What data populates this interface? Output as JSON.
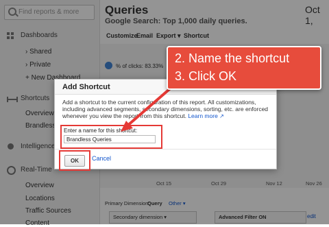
{
  "sidebar": {
    "search_placeholder": "Find reports & more",
    "dashboards": "Dashboards",
    "shared": "› Shared",
    "private": "› Private",
    "new_dashboard": "+ New Dashboard",
    "shortcuts": "Shortcuts",
    "overview": "Overview",
    "brandless": "Brandless Q",
    "intelligence": "Intelligence E",
    "realtime": "Real-Time",
    "rt_overview": "Overview",
    "rt_locations": "Locations",
    "rt_traffic": "Traffic Sources",
    "rt_content": "Content"
  },
  "main": {
    "title": "Queries",
    "subtitle": "Google Search: Top 1,000 daily queries.",
    "date_partial": "Oct 1,",
    "toolbar": [
      "Customize",
      "Email",
      "Export ▾",
      "Shortcut"
    ],
    "clicks_label": "% of clicks: 83.33%",
    "axis_labels": [
      "Oct 15",
      "Oct 29",
      "Nov 12",
      "Nov 26"
    ],
    "primary_dimension": "Primary Dimension:",
    "query": "Query",
    "other": "Other ▾",
    "secondary_dimension": "Secondary dimension ▾",
    "advanced_filter": "Advanced Filter ON",
    "edit": "edit"
  },
  "dialog": {
    "title": "Add Shortcut",
    "description": "Add a shortcut to the current configuration of this report. All customizations, including advanced segments, secondary dimensions, sorting, etc. are enforced whenever you view the report from this shortcut.",
    "learn_more": "Learn more",
    "field_label": "Enter a name for this shortcut:",
    "field_value": "Brandless Queries",
    "ok_label": "OK",
    "cancel_label": "Cancel"
  },
  "callout": {
    "line1": "2. Name the shortcut",
    "line2": "3. Click OK",
    "color": "#e74c3c"
  }
}
